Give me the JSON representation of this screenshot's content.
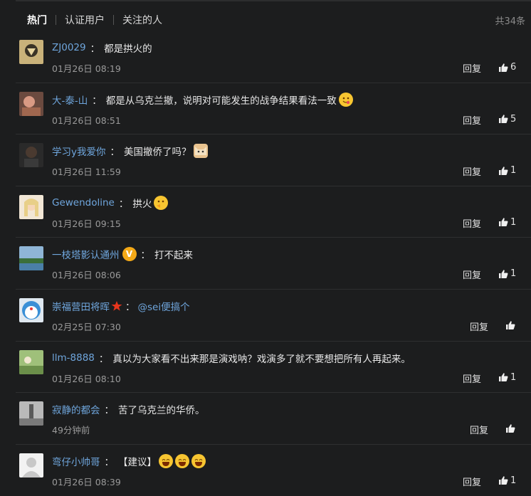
{
  "tabs": [
    {
      "label": "热门",
      "active": true
    },
    {
      "label": "认证用户",
      "active": false
    },
    {
      "label": "关注的人",
      "active": false
    }
  ],
  "total": "共34条",
  "reply_label": "回复",
  "comments": [
    {
      "user": "ZJ0029",
      "text": "都是拱火的",
      "time": "01月26日 08:19",
      "likes": "6"
    },
    {
      "user": "大-泰-山",
      "text": "都是从乌克兰撤，说明对可能发生的战争结果看法一致",
      "time": "01月26日 08:51",
      "likes": "5",
      "emoji": "yum-emoji"
    },
    {
      "user": "学习y我爱你",
      "text": "美国撤侨了吗？",
      "time": "01月26日 11:59",
      "likes": "1",
      "emoji": "cat-emoji"
    },
    {
      "user": "Gewendoline",
      "text": "拱火",
      "time": "01月26日 09:15",
      "likes": "1",
      "emoji": "thinking-emoji"
    },
    {
      "user": "一枝塔影认通州",
      "text": "打不起来",
      "time": "01月26日 08:06",
      "likes": "1",
      "badge": "V"
    },
    {
      "user": "崇福营田将晖",
      "text": "",
      "mention": "@sei便搞个",
      "time": "02月25日 07:30",
      "likes": ""
    },
    {
      "user": "llm-8888",
      "text": "真以为大家看不出来那是演戏呐？戏演多了就不要想把所有人再起来。",
      "time": "01月26日 08:10",
      "likes": "1"
    },
    {
      "user": "寂静的都会",
      "text": "苦了乌克兰的华侨。",
      "time": "49分钟前",
      "likes": ""
    },
    {
      "user": "弯仔小帅哥",
      "text": "【建议】",
      "time": "01月26日 08:39",
      "likes": "1",
      "emoji": "laugh-emoji-x3"
    }
  ]
}
